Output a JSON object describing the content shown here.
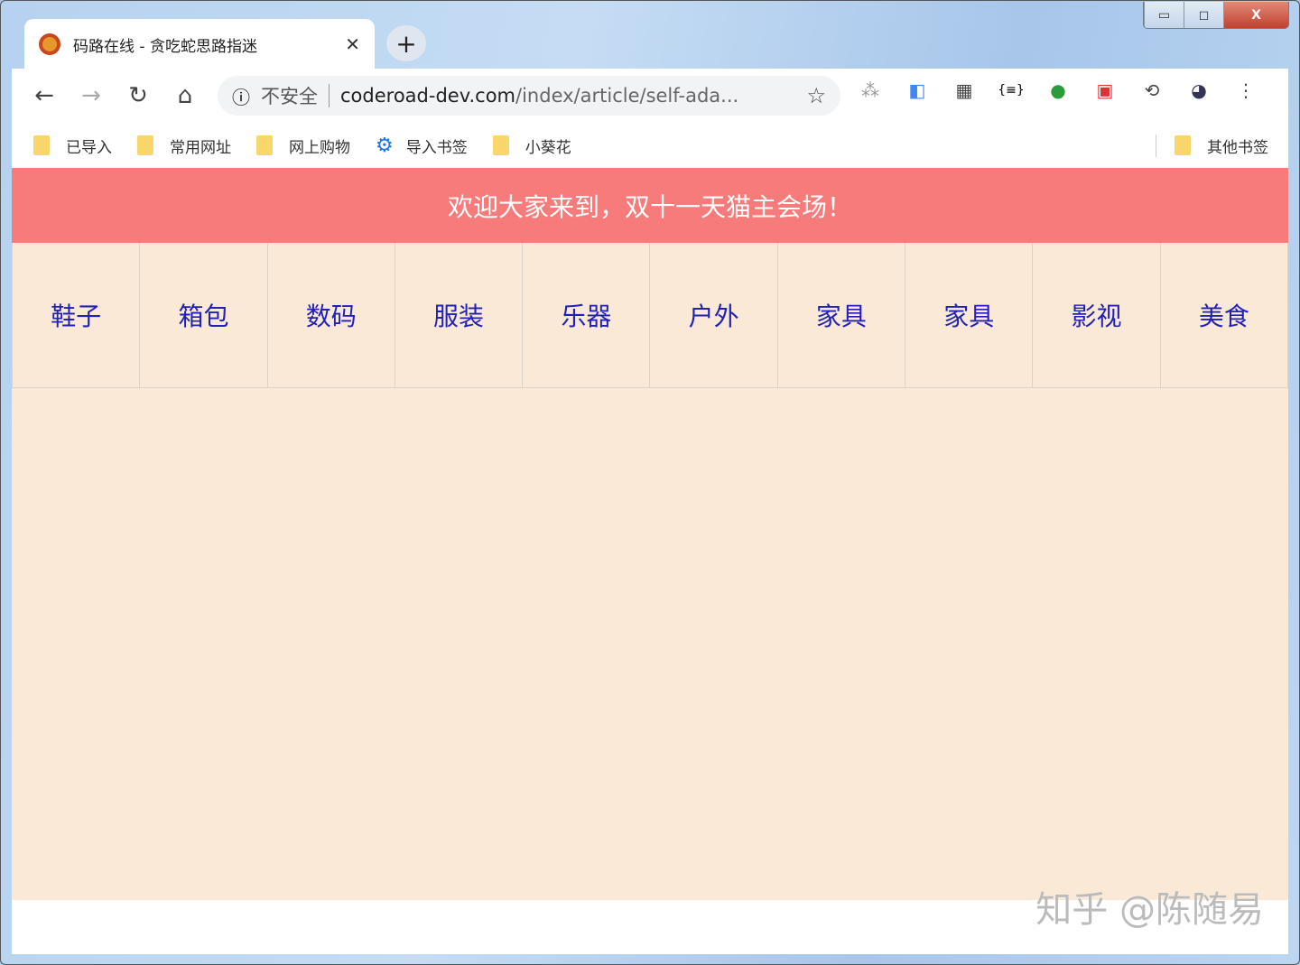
{
  "browser": {
    "tab_title": "码路在线 - 贪吃蛇思路指迷",
    "security_label": "不安全",
    "url_domain": "coderoad-dev.com",
    "url_path": "/index/article/self-ada...",
    "bookmarks": [
      "已导入",
      "常用网址",
      "网上购物",
      "导入书签",
      "小葵花"
    ],
    "other_bookmarks": "其他书签"
  },
  "page": {
    "banner": "欢迎大家来到，双十一天猫主会场！",
    "nav": [
      "鞋子",
      "箱包",
      "数码",
      "服装",
      "乐器",
      "户外",
      "家具",
      "家具",
      "影视",
      "美食"
    ],
    "nav_color": "#2121b8",
    "banner_color": "#f77b7a",
    "background": "#fae9d6"
  },
  "watermark": "知乎 @陈随易"
}
